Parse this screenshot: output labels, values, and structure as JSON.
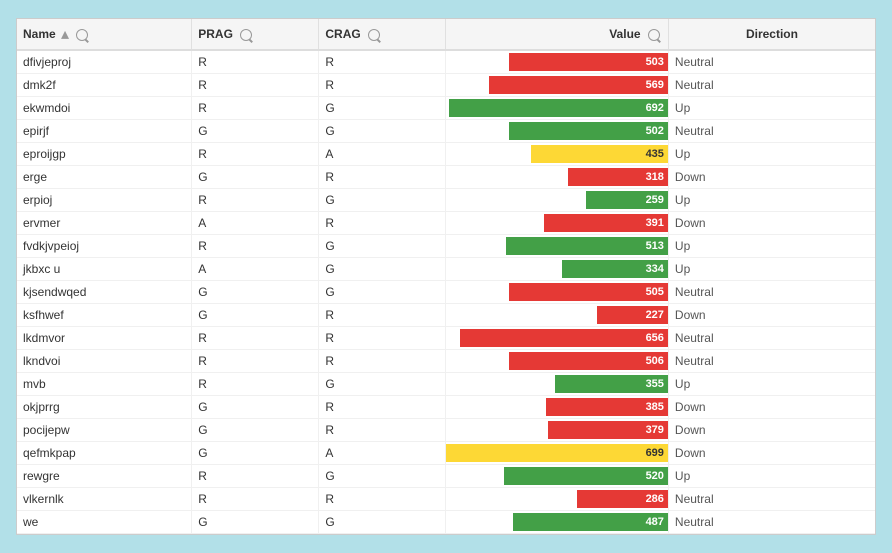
{
  "header": {
    "columns": [
      {
        "key": "name",
        "label": "Name",
        "sortable": true,
        "searchable": true
      },
      {
        "key": "prag",
        "label": "PRAG",
        "sortable": false,
        "searchable": true
      },
      {
        "key": "crag",
        "label": "CRAG",
        "sortable": false,
        "searchable": true
      },
      {
        "key": "value",
        "label": "Value",
        "sortable": false,
        "searchable": true
      },
      {
        "key": "direction",
        "label": "Direction",
        "sortable": false,
        "searchable": false
      }
    ]
  },
  "rows": [
    {
      "name": "dfivjeproj",
      "prag": "R",
      "crag": "R",
      "value": 503,
      "color": "#e53935",
      "direction": "Neutral"
    },
    {
      "name": "dmk2f",
      "prag": "R",
      "crag": "R",
      "value": 569,
      "color": "#e53935",
      "direction": "Neutral"
    },
    {
      "name": "ekwmdoi",
      "prag": "R",
      "crag": "G",
      "value": 692,
      "color": "#43a047",
      "direction": "Up"
    },
    {
      "name": "epirjf",
      "prag": "G",
      "crag": "G",
      "value": 502,
      "color": "#43a047",
      "direction": "Neutral"
    },
    {
      "name": "eproijgp",
      "prag": "R",
      "crag": "A",
      "value": 435,
      "color": "#fdd835",
      "direction": "Up"
    },
    {
      "name": "erge",
      "prag": "G",
      "crag": "R",
      "value": 318,
      "color": "#e53935",
      "direction": "Down"
    },
    {
      "name": "erpioj",
      "prag": "R",
      "crag": "G",
      "value": 259,
      "color": "#43a047",
      "direction": "Up"
    },
    {
      "name": "ervmer",
      "prag": "A",
      "crag": "R",
      "value": 391,
      "color": "#e53935",
      "direction": "Down"
    },
    {
      "name": "fvdkjvpeioj",
      "prag": "R",
      "crag": "G",
      "value": 513,
      "color": "#43a047",
      "direction": "Up"
    },
    {
      "name": "jkbxc u",
      "prag": "A",
      "crag": "G",
      "value": 334,
      "color": "#43a047",
      "direction": "Up"
    },
    {
      "name": "kjsendwqed",
      "prag": "G",
      "crag": "G",
      "value": 505,
      "color": "#e53935",
      "direction": "Neutral"
    },
    {
      "name": "ksfhwef",
      "prag": "G",
      "crag": "R",
      "value": 227,
      "color": "#e53935",
      "direction": "Down"
    },
    {
      "name": "lkdmvor",
      "prag": "R",
      "crag": "R",
      "value": 656,
      "color": "#e53935",
      "direction": "Neutral"
    },
    {
      "name": "lkndvoi",
      "prag": "R",
      "crag": "R",
      "value": 506,
      "color": "#e53935",
      "direction": "Neutral"
    },
    {
      "name": "mvb",
      "prag": "R",
      "crag": "G",
      "value": 355,
      "color": "#43a047",
      "direction": "Up"
    },
    {
      "name": "okjprrg",
      "prag": "G",
      "crag": "R",
      "value": 385,
      "color": "#e53935",
      "direction": "Down"
    },
    {
      "name": "pocijepw",
      "prag": "G",
      "crag": "R",
      "value": 379,
      "color": "#e53935",
      "direction": "Down"
    },
    {
      "name": "qefmkpap",
      "prag": "G",
      "crag": "A",
      "value": 699,
      "color": "#fdd835",
      "direction": "Down"
    },
    {
      "name": "rewgre",
      "prag": "R",
      "crag": "G",
      "value": 520,
      "color": "#43a047",
      "direction": "Up"
    },
    {
      "name": "vlkernlk",
      "prag": "R",
      "crag": "R",
      "value": 286,
      "color": "#e53935",
      "direction": "Neutral"
    },
    {
      "name": "we",
      "prag": "G",
      "crag": "G",
      "value": 487,
      "color": "#43a047",
      "direction": "Neutral"
    }
  ],
  "maxValue": 700
}
